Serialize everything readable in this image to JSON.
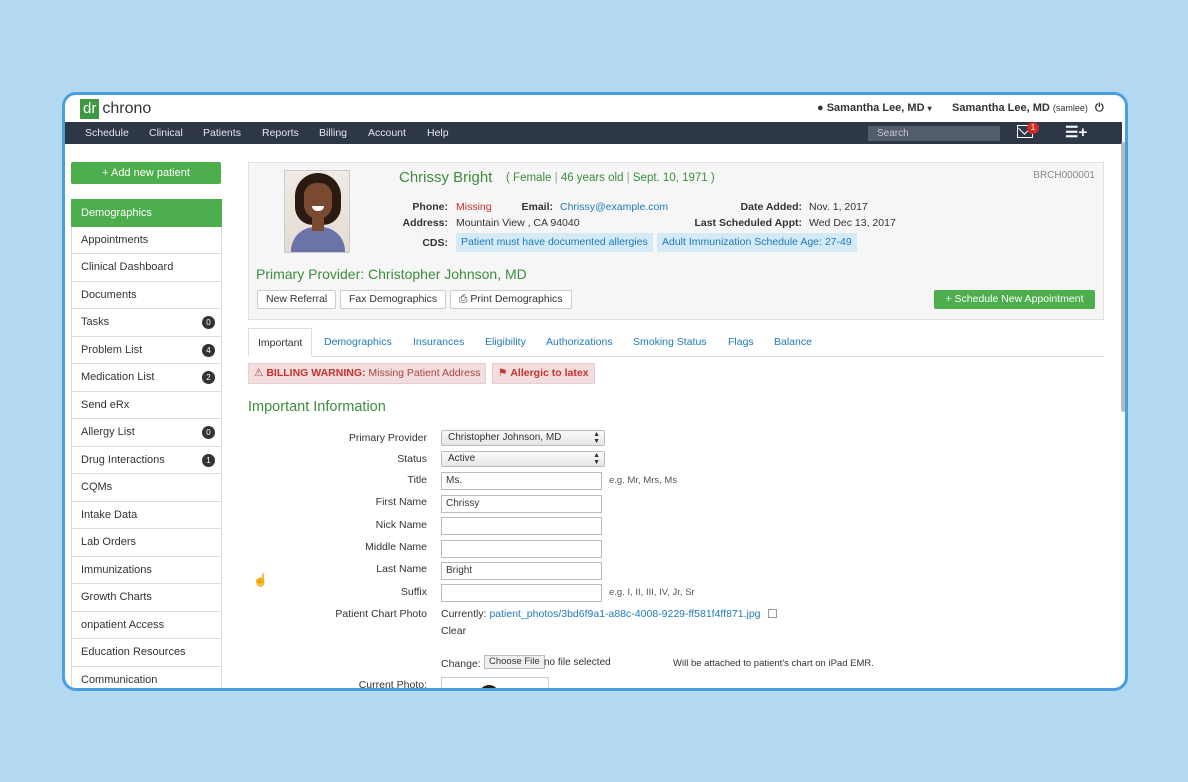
{
  "app": {
    "logo_dr": "dr",
    "logo_chrono": "chrono"
  },
  "header": {
    "user_menu": "Samantha Lee, MD",
    "user_name": "Samantha Lee, MD",
    "user_handle": "(samlee)"
  },
  "nav": {
    "items": [
      "Schedule",
      "Clinical",
      "Patients",
      "Reports",
      "Billing",
      "Account",
      "Help"
    ],
    "search_placeholder": "Search",
    "mail_count": "1"
  },
  "sidebar": {
    "add_button": "+ Add new patient",
    "items": [
      {
        "label": "Demographics",
        "badge": ""
      },
      {
        "label": "Appointments",
        "badge": ""
      },
      {
        "label": "Clinical Dashboard",
        "badge": ""
      },
      {
        "label": "Documents",
        "badge": ""
      },
      {
        "label": "Tasks",
        "badge": "0"
      },
      {
        "label": "Problem List",
        "badge": "4"
      },
      {
        "label": "Medication List",
        "badge": "2"
      },
      {
        "label": "Send eRx",
        "badge": ""
      },
      {
        "label": "Allergy List",
        "badge": "0"
      },
      {
        "label": "Drug Interactions",
        "badge": "1"
      },
      {
        "label": "CQMs",
        "badge": ""
      },
      {
        "label": "Intake Data",
        "badge": ""
      },
      {
        "label": "Lab Orders",
        "badge": ""
      },
      {
        "label": "Immunizations",
        "badge": ""
      },
      {
        "label": "Growth Charts",
        "badge": ""
      },
      {
        "label": "onpatient Access",
        "badge": ""
      },
      {
        "label": "Education Resources",
        "badge": ""
      },
      {
        "label": "Communication",
        "badge": ""
      }
    ]
  },
  "patient": {
    "name": "Chrissy Bright",
    "paren_open": "(",
    "gender": "Female",
    "age": "46 years old",
    "dob": "Sept. 10, 1971",
    "paren_close": ")",
    "divider": "|",
    "chart_id": "BRCH000001",
    "phone_label": "Phone:",
    "phone": "Missing",
    "email_label": "Email:",
    "email": "Chrissy@example.com",
    "date_added_label": "Date Added:",
    "date_added": "Nov. 1, 2017",
    "address_label": "Address:",
    "address": "Mountain View , CA 94040",
    "last_appt_label": "Last Scheduled Appt:",
    "last_appt": "Wed Dec 13, 2017",
    "cds_label": "CDS:",
    "cds_tags": [
      "Patient must have documented allergies",
      "Adult Immunization Schedule Age: 27-49"
    ],
    "primary_provider": "Primary Provider: Christopher Johnson, MD",
    "buttons": {
      "new_referral": "New Referral",
      "fax": "Fax Demographics",
      "print": "Print Demographics",
      "schedule": "+ Schedule New Appointment"
    }
  },
  "tabs": [
    "Important",
    "Demographics",
    "Insurances",
    "Eligibility",
    "Authorizations",
    "Smoking Status",
    "Flags",
    "Balance"
  ],
  "alerts": {
    "billing_bold": "BILLING WARNING:",
    "billing_text": "Missing Patient Address",
    "allergy": "Allergic to latex"
  },
  "form": {
    "title": "Important Information",
    "primary_provider_label": "Primary Provider",
    "primary_provider_value": "Christopher Johnson, MD",
    "status_label": "Status",
    "status_value": "Active",
    "title_label": "Title",
    "title_value": "Ms.",
    "title_hint": "e.g. Mr, Mrs, Ms",
    "first_name_label": "First Name",
    "first_name_value": "Chrissy",
    "nick_name_label": "Nick Name",
    "nick_name_value": "",
    "middle_name_label": "Middle Name",
    "middle_name_value": "",
    "last_name_label": "Last Name",
    "last_name_value": "Bright",
    "suffix_label": "Suffix",
    "suffix_value": "",
    "suffix_hint": "e.g. I, II, III, IV, Jr, Sr",
    "photo_label": "Patient Chart Photo",
    "currently_label": "Currently:",
    "photo_path": "patient_photos/3bd6f9a1-a88c-4008-9229-ff581f4ff871.jpg",
    "clear_label": "Clear",
    "change_label": "Change:",
    "choose_file": "Choose File",
    "no_file": "no file selected",
    "ipad_note": "Will be attached to patient's chart on iPad EMR.",
    "current_photo_label": "Current Photo:"
  },
  "colors": {
    "brand_green": "#4cae4c",
    "nav_dark": "#2d3748",
    "link_blue": "#1f7ab8",
    "frame_blue": "#4a9ee0"
  }
}
